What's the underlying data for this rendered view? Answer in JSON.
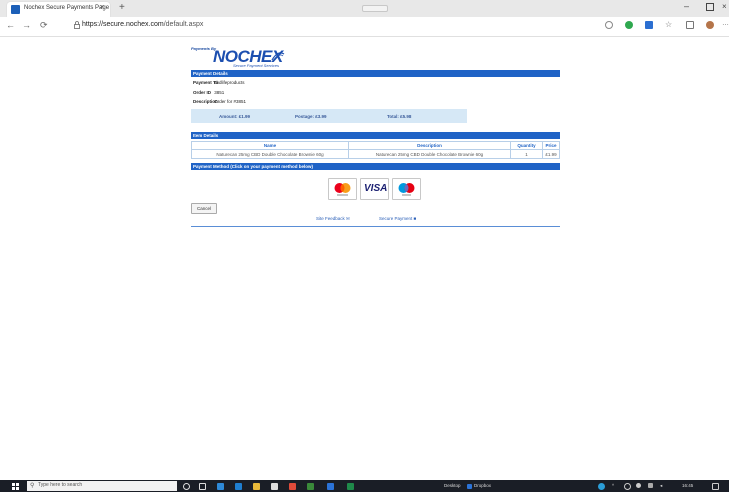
{
  "browser": {
    "tab_title": "Nochex Secure Payments Page",
    "tab_close": "×",
    "new_tab": "+",
    "url_host": "https://secure.nochex.com",
    "url_path": "/default.aspx",
    "min_symbol": "–",
    "close_symbol": "×",
    "back_symbol": "←",
    "forward_symbol": "→",
    "refresh_symbol": "⟳"
  },
  "logo": {
    "small": "Payments By",
    "main": "NOCHEX",
    "sub": "Secure Payment Services"
  },
  "payment_details": {
    "heading": "Payment Details",
    "payment_to_label": "Payment To",
    "payment_to_value": "cbdlifeproducts",
    "order_id_label": "Order ID",
    "order_id_value": "3851",
    "description_label": "Description",
    "description_value": "Order for #3851",
    "amount": "Amount: £1.99",
    "postage": "Postage: £3.99",
    "total": "Total: £5.98"
  },
  "item_details": {
    "heading": "Item Details",
    "columns": [
      "Name",
      "Description",
      "Quantity",
      "Price"
    ],
    "rows": [
      [
        "Naturecan 25mg CBD Double Chocolate Brownie 60g",
        "Naturecan 25mg CBD Double Chocolate Brownie 60g",
        "1",
        "£1.99"
      ]
    ]
  },
  "payment_method": {
    "heading": "Payment Method  (Click on your payment method below)",
    "cards": [
      "mastercard",
      "VISA",
      "maestro"
    ]
  },
  "cancel_label": "Cancel",
  "footer": {
    "feedback": "Site Feedback",
    "secure": "Secure Payment"
  },
  "taskbar": {
    "search_placeholder": "Type here to search",
    "desktop": "Desktop",
    "dropbox": "Dropbox",
    "time": "16:45"
  },
  "colors": {
    "brand_blue": "#1f63c6",
    "amount_bg": "#d6e8f6"
  }
}
